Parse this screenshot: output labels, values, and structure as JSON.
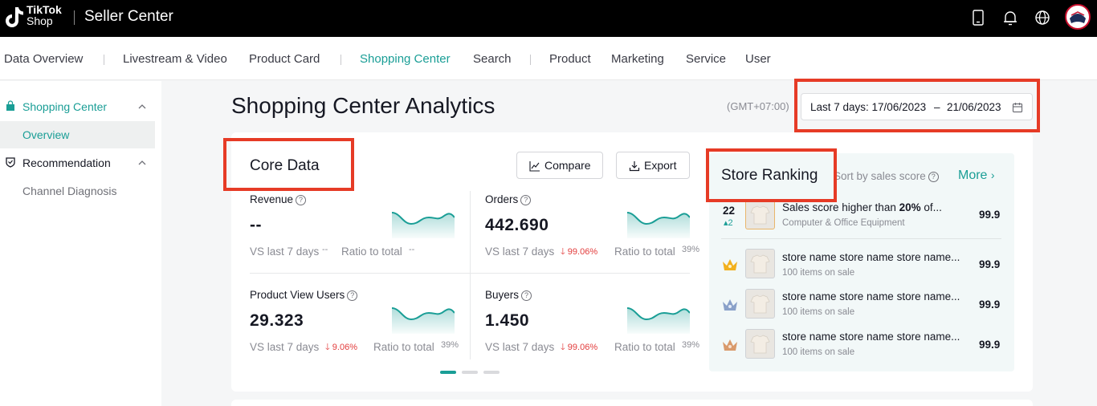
{
  "brand": {
    "logo_line1": "TikTok",
    "logo_line2": "Shop",
    "title": "Seller Center"
  },
  "topbar_icons": [
    "phone-icon",
    "bell-icon",
    "globe-icon"
  ],
  "tabs": [
    {
      "label": "Data Overview"
    },
    {
      "label": "Livestream & Video"
    },
    {
      "label": "Product Card"
    },
    {
      "label": "Shopping Center"
    },
    {
      "label": "Search"
    },
    {
      "label": "Product"
    },
    {
      "label": "Marketing"
    },
    {
      "label": "Service"
    },
    {
      "label": "User"
    }
  ],
  "active_tab": "Shopping Center",
  "sidebar": {
    "group1": "Shopping Center",
    "group1_child": "Overview",
    "group2": "Recommendation",
    "group2_child": "Channel Diagnosis"
  },
  "page": {
    "title": "Shopping Center Analytics",
    "timezone": "(GMT+07:00)",
    "date_range_label": "Last 7 days: 17/06/2023",
    "date_range_sep": "–",
    "date_range_end": "21/06/2023"
  },
  "core": {
    "title": "Core Data",
    "compare": "Compare",
    "export": "Export",
    "metrics": [
      {
        "label": "Revenue",
        "value": "--",
        "vs": "VS last 7 days",
        "change": "--",
        "ratio_label": "Ratio to total",
        "ratio": "--"
      },
      {
        "label": "Orders",
        "value": "442.690",
        "vs": "VS last 7 days",
        "change": "99.06%",
        "ratio_label": "Ratio to total",
        "ratio": "39%"
      },
      {
        "label": "Product View Users",
        "value": "29.323",
        "vs": "VS last 7 days",
        "change": "9.06%",
        "ratio_label": "Ratio to total",
        "ratio": "39%"
      },
      {
        "label": "Buyers",
        "value": "1.450",
        "vs": "VS last 7 days",
        "change": "99.06%",
        "ratio_label": "Ratio to total",
        "ratio": "39%"
      }
    ],
    "pager_pages": 3,
    "pager_current": 1
  },
  "ranking": {
    "title": "Store Ranking",
    "sort": "Sort by sales score",
    "more": "More",
    "mine": {
      "rank": "22",
      "delta": "2",
      "name_pre": "Sales score higher than ",
      "name_bold": "20%",
      "name_post": " of...",
      "sub": "Computer & Office Equipment",
      "score": "99.9"
    },
    "stores": [
      {
        "medal": "gold",
        "name": "store name store name store name...",
        "sub": "100 items on sale",
        "score": "99.9"
      },
      {
        "medal": "silver",
        "name": "store name store name store name...",
        "sub": "100 items on sale",
        "score": "99.9"
      },
      {
        "medal": "bronze",
        "name": "store name store name store name...",
        "sub": "100 items on sale",
        "score": "99.9"
      }
    ]
  },
  "colors": {
    "accent": "#1a9e96",
    "negative": "#e23b3b",
    "highlight_frame": "#e63b26",
    "gold": "#f2b01e",
    "silver": "#8aa1c9",
    "bronze": "#d99a6c"
  }
}
